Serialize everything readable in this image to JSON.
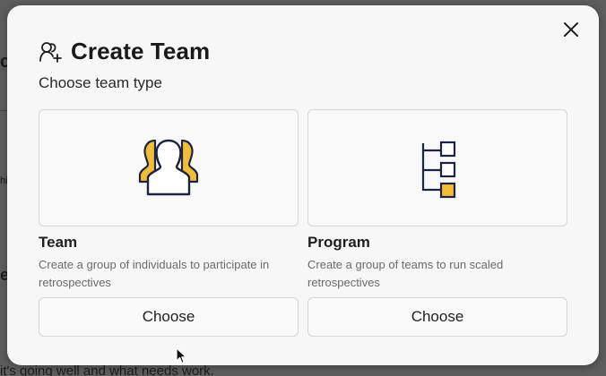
{
  "background": {
    "fragment_top": "c.",
    "fragment_mid": "hi",
    "fragment_heading": "e",
    "fragment_bottom": "it's going well and what needs work."
  },
  "modal": {
    "title": "Create Team",
    "title_icon": "users-plus-icon",
    "close_icon": "close-icon",
    "subtitle": "Choose team type"
  },
  "types": [
    {
      "title": "Team",
      "description": "Create a group of individuals to participate in retrospectives",
      "icon": "team-people-icon",
      "button_label": "Choose"
    },
    {
      "title": "Program",
      "description": "Create a group of teams to run scaled retrospectives",
      "icon": "program-hierarchy-icon",
      "button_label": "Choose"
    }
  ],
  "colors": {
    "accent_yellow": "#f2be3a",
    "icon_navy": "#1d2440",
    "overlay": "#5e5e5e",
    "modal_bg": "#f7f7f7"
  }
}
